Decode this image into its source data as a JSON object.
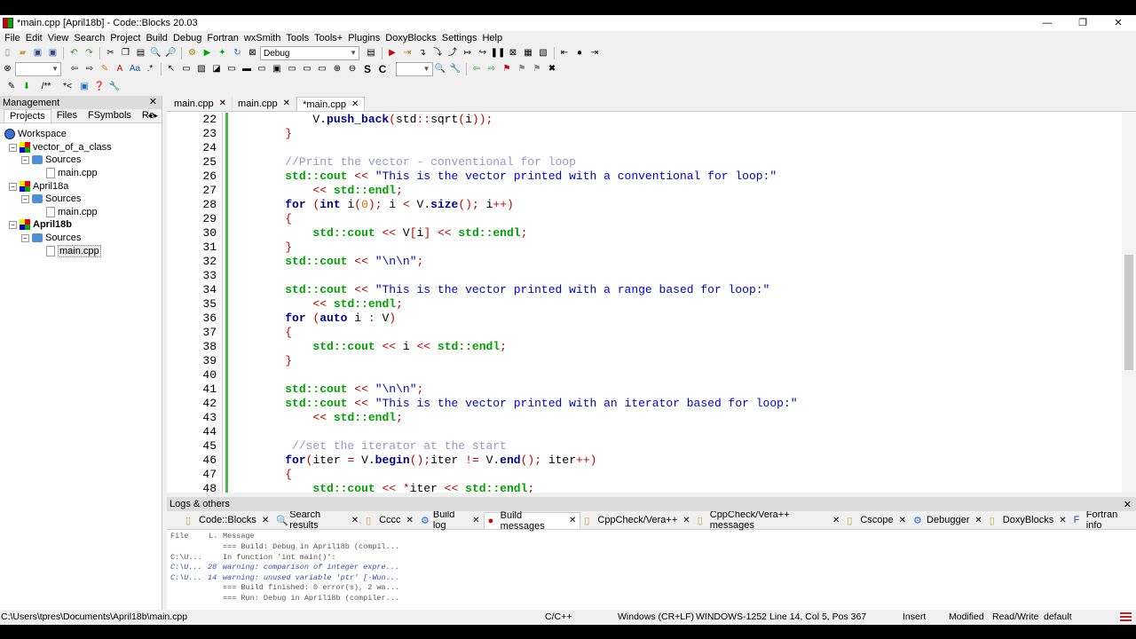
{
  "window": {
    "title": "*main.cpp [April18b] - Code::Blocks 20.03"
  },
  "menu": [
    "File",
    "Edit",
    "View",
    "Search",
    "Project",
    "Build",
    "Debug",
    "Fortran",
    "wxSmith",
    "Tools",
    "Tools+",
    "Plugins",
    "DoxyBlocks",
    "Settings",
    "Help"
  ],
  "toolbar": {
    "build_target": "Debug",
    "icons": [
      "new-file-icon",
      "open-icon",
      "save-icon",
      "save-all-icon",
      "undo-icon",
      "redo-icon",
      "cut-icon",
      "copy-icon",
      "paste-icon",
      "find-icon",
      "replace-icon",
      "build-icon",
      "run-icon",
      "build-run-icon",
      "rebuild-icon",
      "abort-icon"
    ]
  },
  "management": {
    "title": "Management",
    "tabs": [
      "Projects",
      "Files",
      "FSymbols",
      "Re"
    ],
    "tree": [
      {
        "label": "Workspace",
        "type": "workspace",
        "level": 0
      },
      {
        "label": "vector_of_a_class",
        "type": "project",
        "level": 1
      },
      {
        "label": "Sources",
        "type": "folder",
        "level": 2
      },
      {
        "label": "main.cpp",
        "type": "file",
        "level": 3
      },
      {
        "label": "April18a",
        "type": "project",
        "level": 1
      },
      {
        "label": "Sources",
        "type": "folder",
        "level": 2
      },
      {
        "label": "main.cpp",
        "type": "file",
        "level": 3
      },
      {
        "label": "April18b",
        "type": "project",
        "level": 1,
        "bold": true
      },
      {
        "label": "Sources",
        "type": "folder",
        "level": 2
      },
      {
        "label": "main.cpp",
        "type": "file",
        "level": 3,
        "selected": true
      }
    ]
  },
  "editor": {
    "tabs": [
      {
        "label": "main.cpp",
        "active": false
      },
      {
        "label": "main.cpp",
        "active": false
      },
      {
        "label": "*main.cpp",
        "active": true
      }
    ],
    "lines": [
      {
        "n": "22",
        "t": "        V.push_back(std::sqrt(i));"
      },
      {
        "n": "23",
        "t": "    }"
      },
      {
        "n": "24",
        "t": ""
      },
      {
        "n": "25",
        "t": "    //Print the vector - conventional for loop"
      },
      {
        "n": "26",
        "t": "    std::cout << \"This is the vector printed with a conventional for loop:\""
      },
      {
        "n": "27",
        "t": "        << std::endl;"
      },
      {
        "n": "28",
        "t": "    for (int i(0); i < V.size(); i++)"
      },
      {
        "n": "29",
        "t": "    {"
      },
      {
        "n": "30",
        "t": "        std::cout << V[i] << std::endl;"
      },
      {
        "n": "31",
        "t": "    }"
      },
      {
        "n": "32",
        "t": "    std::cout << \"\\n\\n\";"
      },
      {
        "n": "33",
        "t": ""
      },
      {
        "n": "34",
        "t": "    std::cout << \"This is the vector printed with a range based for loop:\""
      },
      {
        "n": "35",
        "t": "        << std::endl;"
      },
      {
        "n": "36",
        "t": "    for (auto i : V)"
      },
      {
        "n": "37",
        "t": "    {"
      },
      {
        "n": "38",
        "t": "        std::cout << i << std::endl;"
      },
      {
        "n": "39",
        "t": "    }"
      },
      {
        "n": "40",
        "t": ""
      },
      {
        "n": "41",
        "t": "    std::cout << \"\\n\\n\";"
      },
      {
        "n": "42",
        "t": "    std::cout << \"This is the vector printed with an iterator based for loop:\""
      },
      {
        "n": "43",
        "t": "        << std::endl;"
      },
      {
        "n": "44",
        "t": ""
      },
      {
        "n": "45",
        "t": "     //set the iterator at the start"
      },
      {
        "n": "46",
        "t": "    for(iter = V.begin();iter != V.end(); iter++)"
      },
      {
        "n": "47",
        "t": "    {"
      },
      {
        "n": "48",
        "t": "        std::cout << *iter << std::endl;"
      }
    ]
  },
  "logs": {
    "title": "Logs & others",
    "tabs": [
      {
        "label": "Code::Blocks",
        "icon": "document-icon"
      },
      {
        "label": "Search results",
        "icon": "search-icon"
      },
      {
        "label": "Cccc",
        "icon": "document-icon"
      },
      {
        "label": "Build log",
        "icon": "gear-icon"
      },
      {
        "label": "Build messages",
        "icon": "pin-icon",
        "active": true
      },
      {
        "label": "CppCheck/Vera++",
        "icon": "document-icon"
      },
      {
        "label": "CppCheck/Vera++ messages",
        "icon": "document-icon"
      },
      {
        "label": "Cscope",
        "icon": "document-icon"
      },
      {
        "label": "Debugger",
        "icon": "gear-icon"
      },
      {
        "label": "DoxyBlocks",
        "icon": "document-icon"
      },
      {
        "label": "Fortran info",
        "icon": "fortran-icon"
      }
    ],
    "columns": [
      "File",
      "L.",
      "Message"
    ],
    "rows": [
      {
        "file": "",
        "line": "",
        "msg": "=== Build: Debug in April18b (compil...",
        "kind": "info"
      },
      {
        "file": "C:\\U...",
        "line": "",
        "msg": "In function 'int main()':",
        "kind": "info"
      },
      {
        "file": "C:\\U...",
        "line": "28",
        "msg": "warning: comparison of integer expre...",
        "kind": "warn"
      },
      {
        "file": "C:\\U...",
        "line": "14",
        "msg": "warning: unused variable 'ptr' [-Wun...",
        "kind": "warn"
      },
      {
        "file": "",
        "line": "",
        "msg": "=== Build finished: 0 error(s), 2 wa...",
        "kind": "info"
      },
      {
        "file": "",
        "line": "",
        "msg": "=== Run: Debug in April18b (compiler...",
        "kind": "info"
      }
    ]
  },
  "status": {
    "path": "C:\\Users\\tpres\\Documents\\April18b\\main.cpp",
    "lang": "C/C++",
    "eol": "Windows (CR+LF)",
    "encoding": "WINDOWS-1252",
    "position": "Line 14, Col 5, Pos 367",
    "mode": "Insert",
    "modified": "Modified",
    "access": "Read/Write",
    "theme": "default"
  }
}
